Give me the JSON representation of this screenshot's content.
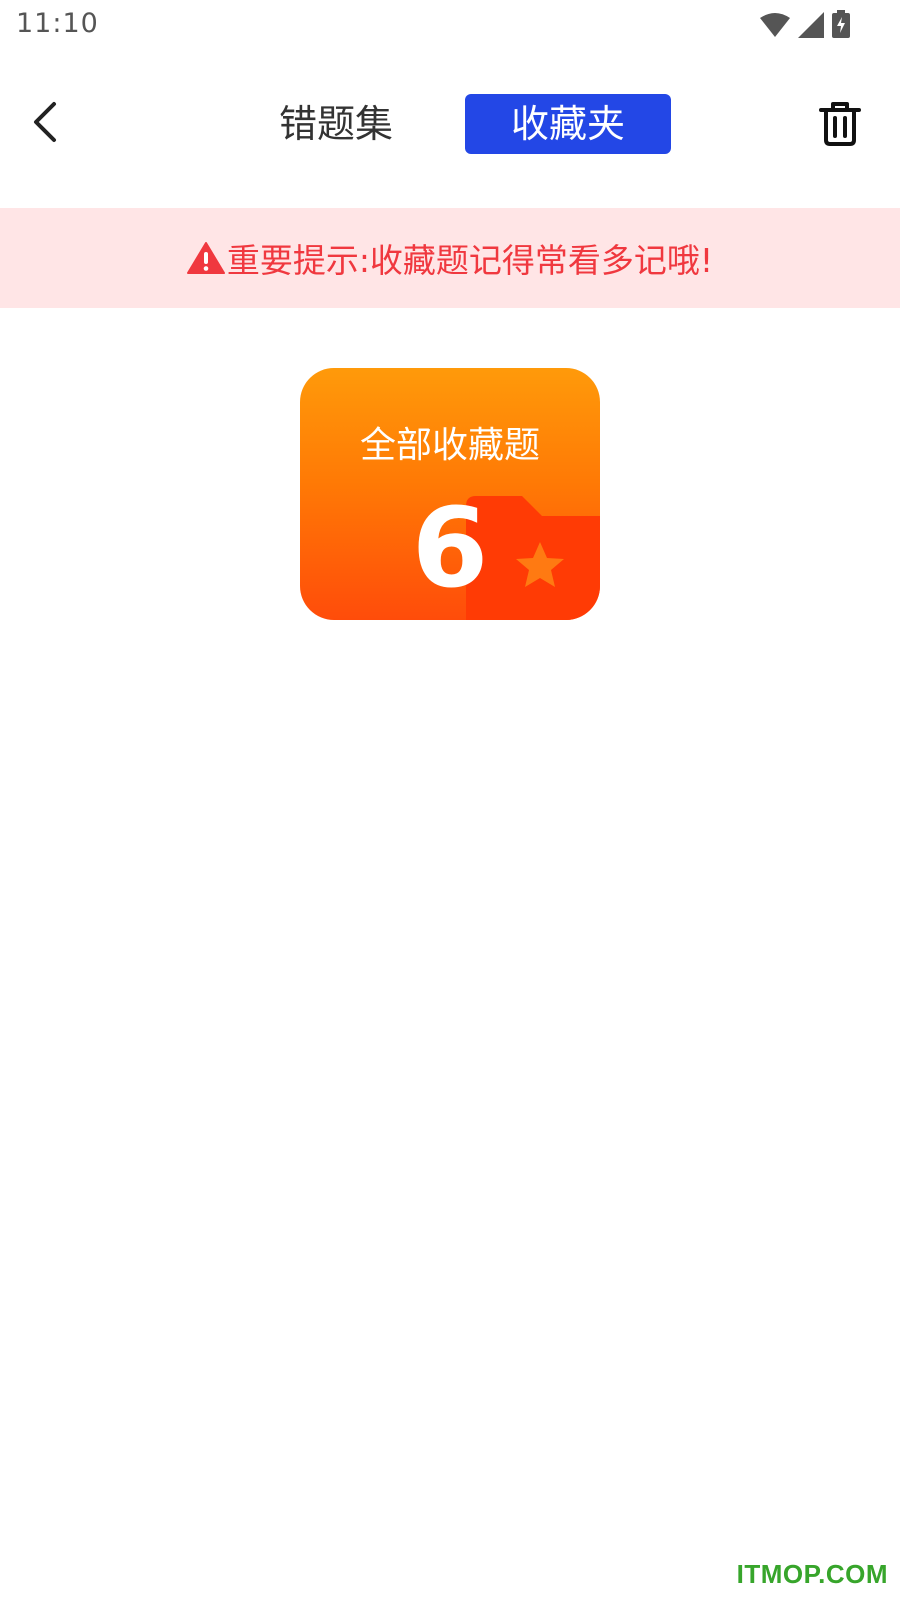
{
  "status_bar": {
    "time": "11:10",
    "icons": [
      "wifi-icon",
      "signal-icon",
      "battery-charging-icon"
    ]
  },
  "nav": {
    "back_icon": "chevron-left-icon",
    "tabs": [
      {
        "label": "错题集",
        "active": false
      },
      {
        "label": "收藏夹",
        "active": true
      }
    ],
    "trash_icon": "trash-icon"
  },
  "notice": {
    "icon": "warning-icon",
    "text": "重要提示:收藏题记得常看多记哦!"
  },
  "card": {
    "title": "全部收藏题",
    "count": "6",
    "icon": "star-folder-icon"
  },
  "watermark": "ITMOP.COM",
  "colors": {
    "tab_active": "#2347e6",
    "notice_bg": "#ffe5e6",
    "notice_text": "#f0383f",
    "card_top": "#ff9a0a",
    "card_bottom": "#ff4c0a",
    "watermark": "#37a52b"
  }
}
